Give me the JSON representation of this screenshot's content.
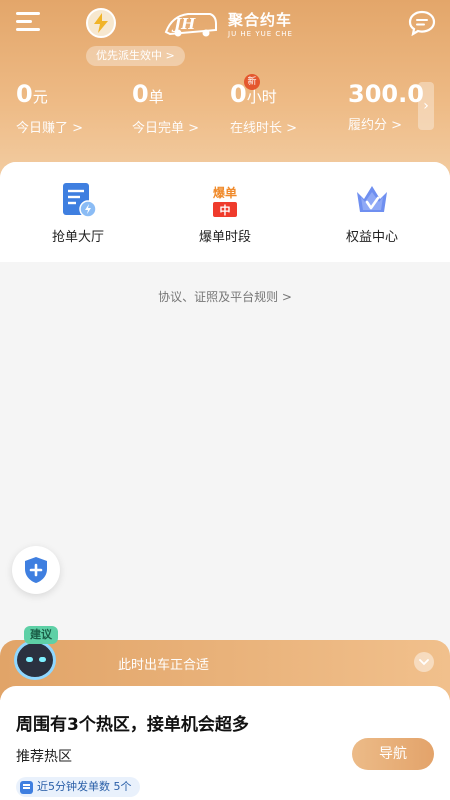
{
  "header": {
    "logo_cn": "聚合约车",
    "logo_en": "JU HE YUE CHE",
    "logo_mark": "JH",
    "priority_badge": "优先派生效中 >",
    "icons": {
      "menu": "menu-icon",
      "bolt": "lightning-icon",
      "chat": "chat-icon"
    }
  },
  "stats": [
    {
      "value": "0",
      "unit": "元",
      "label": "今日赚了 >"
    },
    {
      "value": "0",
      "unit": "单",
      "label": "今日完单 >"
    },
    {
      "value": "0",
      "unit": "小时",
      "label": "在线时长 >",
      "badge": "新"
    },
    {
      "value": "300.0",
      "unit": "",
      "label": "履约分 >"
    }
  ],
  "features": [
    {
      "label": "抢单大厅",
      "icon": "order-hall-icon"
    },
    {
      "label": "爆单时段",
      "icon": "peak-hours-icon",
      "icon_text_top": "爆单",
      "icon_text_bottom": "中"
    },
    {
      "label": "权益中心",
      "icon": "crown-icon"
    }
  ],
  "rules_link": "协议、证照及平台规则 >",
  "suggest": {
    "tag": "建议",
    "text": "此时出车正合适"
  },
  "hot_panel": {
    "title": "周围有3个热区，接单机会超多",
    "subtitle": "推荐热区",
    "nav_button": "导航",
    "orders_pill": "近5分钟发单数 5个"
  },
  "colors": {
    "header_gradient_start": "#e3a66a",
    "header_gradient_end": "#f3cfa6",
    "accent": "#e3a36a",
    "badge_red": "#e4572e",
    "shield_blue": "#3f7fe0"
  }
}
